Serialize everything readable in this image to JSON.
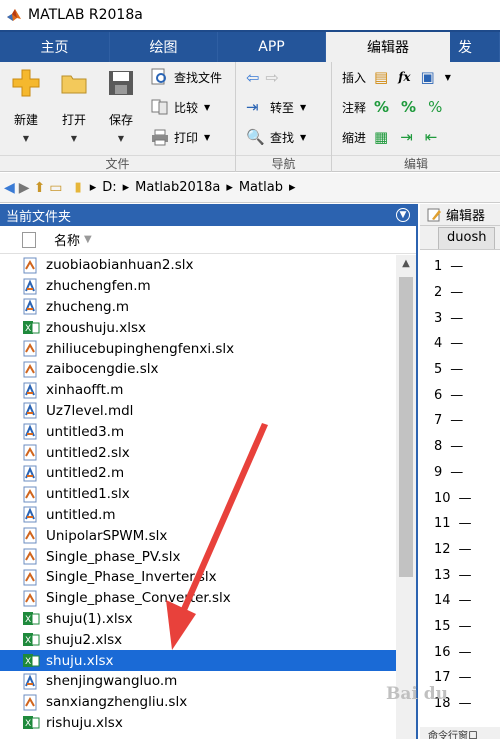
{
  "window": {
    "title": "MATLAB R2018a"
  },
  "tabs": [
    {
      "label": "主页",
      "active": false
    },
    {
      "label": "绘图",
      "active": false
    },
    {
      "label": "APP",
      "active": false
    },
    {
      "label": "编辑器",
      "active": true
    },
    {
      "label": "发",
      "active": false
    }
  ],
  "ribbon": {
    "file_group": {
      "label": "文件",
      "new_label": "新建",
      "open_label": "打开",
      "save_label": "保存",
      "find_files_label": "查找文件",
      "compare_label": "比较",
      "print_label": "打印"
    },
    "nav_group": {
      "label": "导航",
      "goto_label": "转至",
      "find_label": "查找"
    },
    "edit_group": {
      "label": "编辑",
      "insert_label": "插入",
      "comment_label": "注释",
      "indent_label": "缩进"
    }
  },
  "address": {
    "segments": [
      "D:",
      "Matlab2018a",
      "Matlab"
    ]
  },
  "current_folder": {
    "title": "当前文件夹",
    "column_name": "名称",
    "files": [
      {
        "name": "zuobiaobianhuan2.slx",
        "type": "slx",
        "selected": false
      },
      {
        "name": "zhuchengfen.m",
        "type": "m",
        "selected": false
      },
      {
        "name": "zhucheng.m",
        "type": "m",
        "selected": false
      },
      {
        "name": "zhoushuju.xlsx",
        "type": "xlsx",
        "selected": false
      },
      {
        "name": "zhiliucebupinghengfenxi.slx",
        "type": "slx",
        "selected": false
      },
      {
        "name": "zaibocengdie.slx",
        "type": "slx",
        "selected": false
      },
      {
        "name": "xinhaofft.m",
        "type": "m",
        "selected": false
      },
      {
        "name": "Uz7level.mdl",
        "type": "m",
        "selected": false
      },
      {
        "name": "untitled3.m",
        "type": "m",
        "selected": false
      },
      {
        "name": "untitled2.slx",
        "type": "slx",
        "selected": false
      },
      {
        "name": "untitled2.m",
        "type": "m",
        "selected": false
      },
      {
        "name": "untitled1.slx",
        "type": "slx",
        "selected": false
      },
      {
        "name": "untitled.m",
        "type": "m",
        "selected": false
      },
      {
        "name": "UnipolarSPWM.slx",
        "type": "slx",
        "selected": false
      },
      {
        "name": "Single_phase_PV.slx",
        "type": "slx",
        "selected": false
      },
      {
        "name": "Single_Phase_Inverter.slx",
        "type": "slx",
        "selected": false
      },
      {
        "name": "Single_phase_Converter.slx",
        "type": "slx",
        "selected": false
      },
      {
        "name": "shuju(1).xlsx",
        "type": "xlsx",
        "selected": false
      },
      {
        "name": "shuju2.xlsx",
        "type": "xlsx",
        "selected": false
      },
      {
        "name": "shuju.xlsx",
        "type": "xlsx",
        "selected": true
      },
      {
        "name": "shenjingwangluo.m",
        "type": "m",
        "selected": false
      },
      {
        "name": "sanxiangzhengliu.slx",
        "type": "slx",
        "selected": false
      },
      {
        "name": "rishuju.xlsx",
        "type": "xlsx",
        "selected": false
      }
    ]
  },
  "editor": {
    "title": "编辑器",
    "file_tab": "duosh",
    "line_numbers": [
      "1",
      "2",
      "3",
      "4",
      "5",
      "6",
      "7",
      "8",
      "9",
      "10",
      "11",
      "12",
      "13",
      "14",
      "15",
      "16",
      "17",
      "18"
    ],
    "status": "命令行窗口"
  },
  "watermark": "Bai du",
  "colors": {
    "tabbar": "#1e4a8a",
    "panel_title": "#2c63b0",
    "selection": "#1a6ad6",
    "arrow": "#e8413b"
  }
}
